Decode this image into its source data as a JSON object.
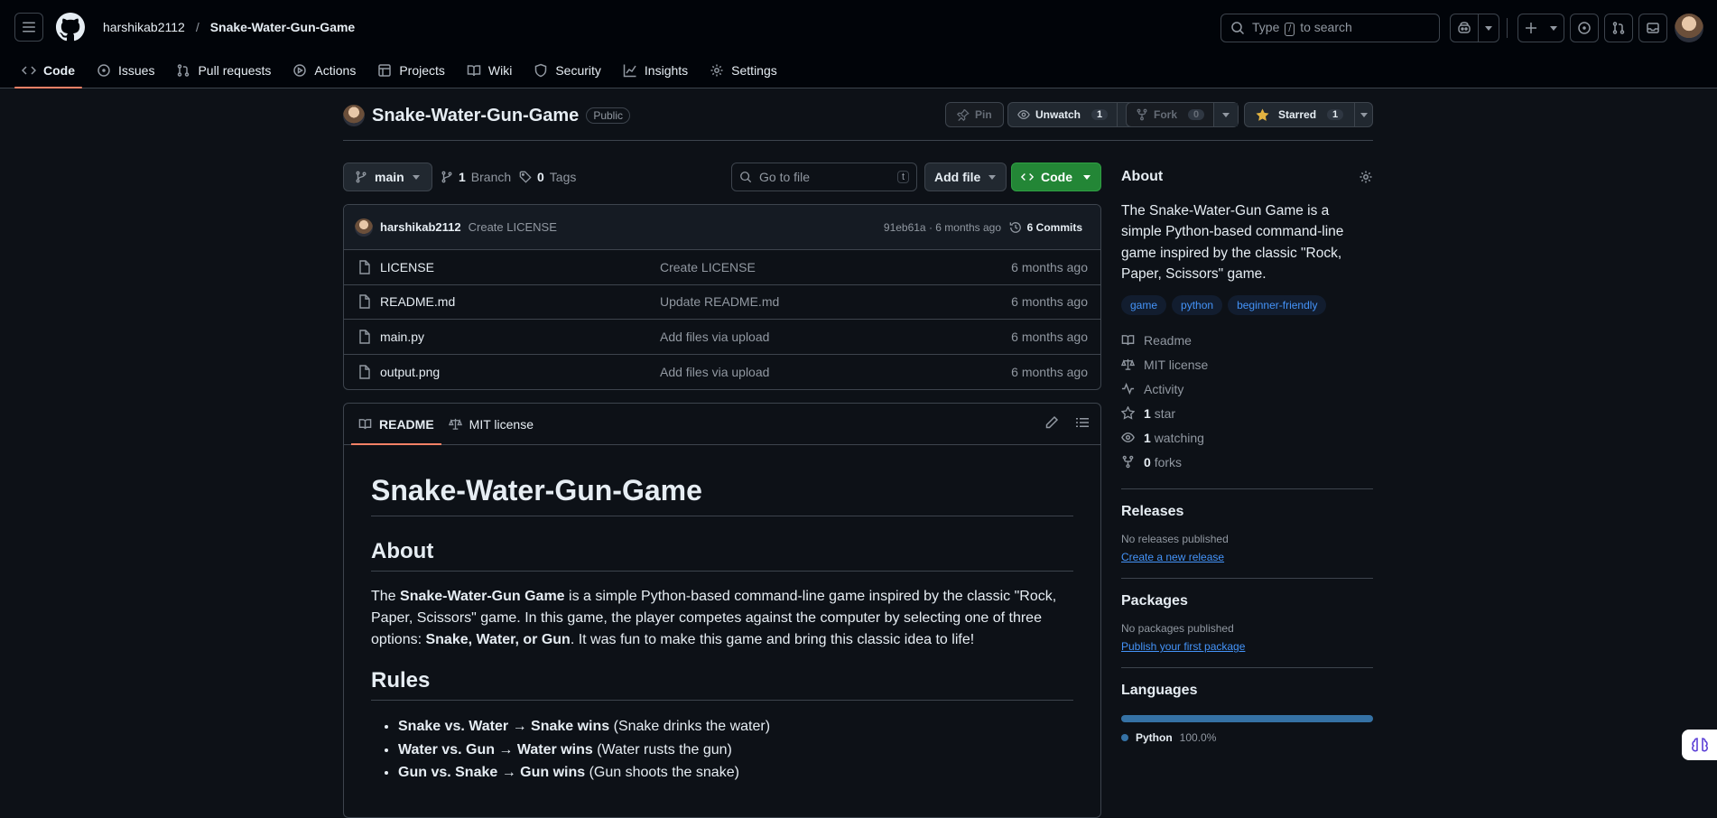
{
  "header": {
    "owner": "harshikab2112",
    "separator": "/",
    "repo": "Snake-Water-Gun-Game",
    "search_prefix": "Type",
    "search_key": "/",
    "search_suffix": "to search"
  },
  "nav": {
    "items": [
      {
        "label": "Code",
        "icon": "code-icon",
        "active": true
      },
      {
        "label": "Issues",
        "icon": "issue-icon"
      },
      {
        "label": "Pull requests",
        "icon": "pull-request-icon"
      },
      {
        "label": "Actions",
        "icon": "play-icon"
      },
      {
        "label": "Projects",
        "icon": "table-icon"
      },
      {
        "label": "Wiki",
        "icon": "book-icon"
      },
      {
        "label": "Security",
        "icon": "shield-icon"
      },
      {
        "label": "Insights",
        "icon": "graph-icon"
      },
      {
        "label": "Settings",
        "icon": "gear-icon"
      }
    ]
  },
  "repo": {
    "name": "Snake-Water-Gun-Game",
    "visibility": "Public",
    "pin_label": "Pin",
    "watch_label": "Unwatch",
    "watch_count": "1",
    "fork_label": "Fork",
    "fork_count": "0",
    "star_label": "Starred",
    "star_count": "1"
  },
  "filebar": {
    "branch": "main",
    "branches_count": "1",
    "branches_label": "Branch",
    "tags_count": "0",
    "tags_label": "Tags",
    "goto_placeholder": "Go to file",
    "goto_key": "t",
    "add_file": "Add file",
    "code": "Code"
  },
  "commit": {
    "user": "harshikab2112",
    "message": "Create LICENSE",
    "hash": "91eb61a · 6 months ago",
    "commits": "6 Commits"
  },
  "files": [
    {
      "name": "LICENSE",
      "message": "Create LICENSE",
      "age": "6 months ago"
    },
    {
      "name": "README.md",
      "message": "Update README.md",
      "age": "6 months ago"
    },
    {
      "name": "main.py",
      "message": "Add files via upload",
      "age": "6 months ago"
    },
    {
      "name": "output.png",
      "message": "Add files via upload",
      "age": "6 months ago"
    }
  ],
  "readme": {
    "tab_readme": "README",
    "tab_license": "MIT license",
    "h1": "Snake-Water-Gun-Game",
    "about_h": "About",
    "p1_a": "The ",
    "p1_b": "Snake-Water-Gun Game",
    "p1_c": " is a simple Python-based command-line game inspired by the classic \"Rock, Paper, Scissors\" game. In this game, the player competes against the computer by selecting one of three options: ",
    "p1_d": "Snake, Water, or Gun",
    "p1_e": ". It was fun to make this game and bring this classic idea to life!",
    "rules_h": "Rules",
    "rules": [
      {
        "bold": "Snake vs. Water → Snake wins",
        "rest": " (Snake drinks the water)"
      },
      {
        "bold": "Water vs. Gun → Water wins",
        "rest": " (Water rusts the gun)"
      },
      {
        "bold": "Gun vs. Snake → Gun wins",
        "rest": " (Gun shoots the snake)"
      }
    ]
  },
  "sidebar": {
    "about_title": "About",
    "description": "The Snake-Water-Gun Game is a simple Python-based command-line game inspired by the classic \"Rock, Paper, Scissors\" game.",
    "topics": [
      "game",
      "python",
      "beginner-friendly"
    ],
    "items": [
      {
        "icon": "book-icon",
        "label": "Readme"
      },
      {
        "icon": "scale-icon",
        "label": "MIT license"
      },
      {
        "icon": "pulse-icon",
        "label": "Activity"
      },
      {
        "icon": "star-icon",
        "count": "1",
        "label": "star"
      },
      {
        "icon": "eye-icon",
        "count": "1",
        "label": "watching"
      },
      {
        "icon": "fork-icon",
        "count": "0",
        "label": "forks"
      }
    ],
    "releases_title": "Releases",
    "releases_text": "No releases published",
    "releases_link": "Create a new release",
    "packages_title": "Packages",
    "packages_text": "No packages published",
    "packages_link": "Publish your first package",
    "languages_title": "Languages",
    "language": "Python",
    "language_pct": "100.0%",
    "language_color": "#3572a5"
  },
  "colors": {
    "accent": "#f78166",
    "primary_button": "#238636",
    "link": "#4493f8"
  }
}
